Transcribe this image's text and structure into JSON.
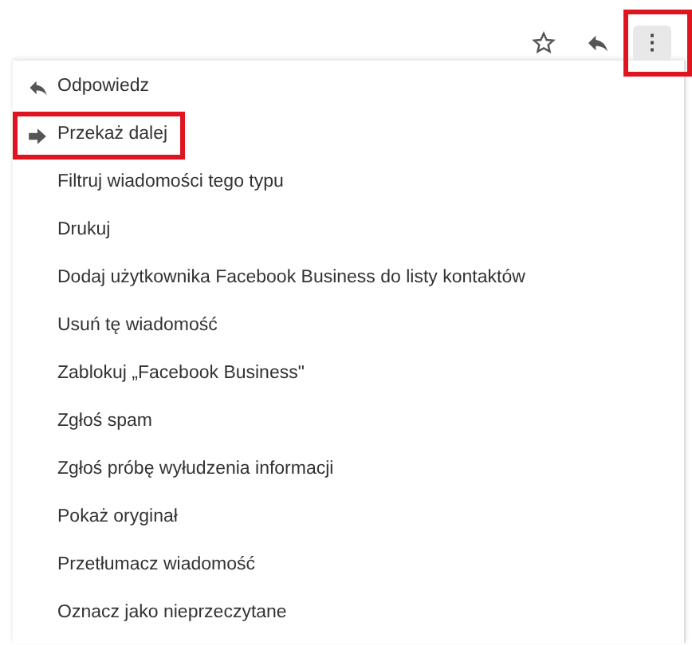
{
  "toolbar": {
    "more_button": {
      "label": "⋮",
      "highlighted": true
    }
  },
  "menu": {
    "items": [
      {
        "label": "Odpowiedz",
        "kind": "reply",
        "highlighted": false
      },
      {
        "label": "Przekaż dalej",
        "kind": "forward",
        "highlighted": true
      },
      {
        "label": "Filtruj wiadomości tego typu",
        "kind": "plain",
        "highlighted": false
      },
      {
        "label": "Drukuj",
        "kind": "plain",
        "highlighted": false
      },
      {
        "label": "Dodaj użytkownika Facebook Business do listy kontaktów",
        "kind": "plain",
        "highlighted": false
      },
      {
        "label": "Usuń tę wiadomość",
        "kind": "plain",
        "highlighted": false
      },
      {
        "label": "Zablokuj „Facebook Business\"",
        "kind": "plain",
        "highlighted": false
      },
      {
        "label": "Zgłoś spam",
        "kind": "plain",
        "highlighted": false
      },
      {
        "label": "Zgłoś próbę wyłudzenia informacji",
        "kind": "plain",
        "highlighted": false
      },
      {
        "label": "Pokaż oryginał",
        "kind": "plain",
        "highlighted": false
      },
      {
        "label": "Przetłumacz wiadomość",
        "kind": "plain",
        "highlighted": false
      },
      {
        "label": "Oznacz jako nieprzeczytane",
        "kind": "plain",
        "highlighted": false
      }
    ]
  }
}
